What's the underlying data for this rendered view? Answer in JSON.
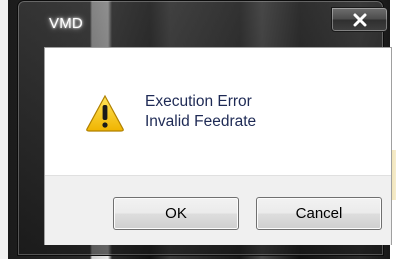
{
  "window": {
    "title": "VMD",
    "close_icon": "close-icon"
  },
  "dialog": {
    "icon": "warning-icon",
    "message_line1": "Execution Error",
    "message_line2": "Invalid Feedrate"
  },
  "buttons": {
    "ok_label": "OK",
    "cancel_label": "Cancel"
  },
  "colors": {
    "message_text": "#1e2a55",
    "warning_yellow": "#f5c400",
    "button_border": "#707070",
    "footer_bg": "#f0f0f0"
  }
}
